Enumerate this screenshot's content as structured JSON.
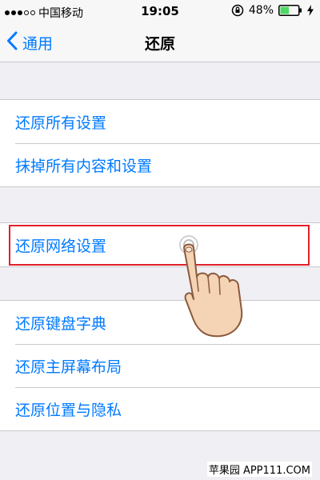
{
  "status_bar": {
    "carrier": "中国移动",
    "time": "19:05",
    "battery_percent": "48%",
    "battery_level": 0.48
  },
  "nav": {
    "back_label": "通用",
    "title": "还原"
  },
  "groups": [
    {
      "rows": [
        "还原所有设置",
        "抹掉所有内容和设置"
      ]
    },
    {
      "rows": [
        "还原网络设置"
      ]
    },
    {
      "rows": [
        "还原键盘字典",
        "还原主屏幕布局",
        "还原位置与隐私"
      ]
    }
  ],
  "colors": {
    "accent": "#007aff",
    "highlight": "#e0202a",
    "background": "#efeff4"
  },
  "watermark": {
    "text": "苹果园 APP111.COM"
  },
  "icons": [
    "signal-icon",
    "rotation-lock-icon",
    "battery-icon",
    "charging-icon",
    "chevron-left-icon",
    "hand-pointer-icon"
  ]
}
